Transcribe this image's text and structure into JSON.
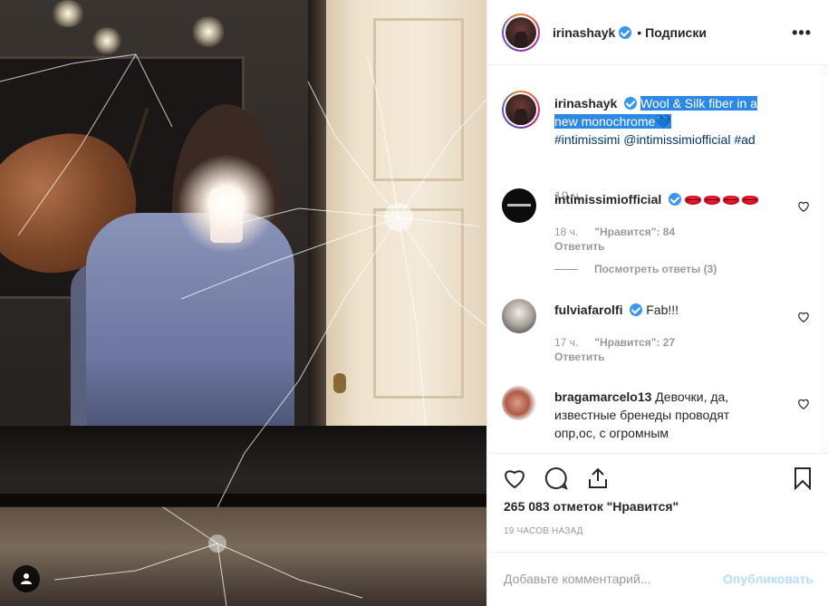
{
  "post": {
    "author": "irinashayk",
    "follow_label": "Подписки",
    "more_label": "•••"
  },
  "caption": {
    "author": "irinashayk",
    "text_highlighted_1": "Wool & Silk fiber in a",
    "text_highlighted_2": "new monochrome",
    "hashtags": [
      "#intimissimi",
      "@intimissimiofficial",
      "#ad"
    ],
    "time": "19 ч."
  },
  "comments": [
    {
      "author": "intimissimiofficial",
      "verified": true,
      "text": "",
      "time": "18 ч.",
      "likes_label": "\"Нравится\": 84",
      "reply_label": "Ответить",
      "view_replies": "Посмотреть ответы (3)"
    },
    {
      "author": "fulviafarolfi",
      "verified": true,
      "text": "Fab!!!",
      "time": "17 ч.",
      "likes_label": "\"Нравится\": 27",
      "reply_label": "Ответить"
    },
    {
      "author": "bragamarcelo13",
      "verified": false,
      "text_lines": [
        "Девочки, да,",
        "известные бренеды проводят",
        "опр,ос, с огромным"
      ]
    }
  ],
  "stats": {
    "likes": "265 083 отметок \"Нравится\"",
    "time_ago": "19 часов назад"
  },
  "composer": {
    "placeholder": "Добавьте комментарий...",
    "publish_label": "Опубликовать"
  },
  "colors": {
    "accent": "#3897f0",
    "highlight": "#2c88e6",
    "link": "#003569",
    "muted": "#999999",
    "publish_disabled": "#b2dffc"
  },
  "icons": [
    "heart-icon",
    "comment-icon",
    "share-icon",
    "bookmark-icon",
    "user-tag-icon",
    "verified-icon",
    "more-icon",
    "blue-heart-emoji",
    "lips-emoji"
  ]
}
